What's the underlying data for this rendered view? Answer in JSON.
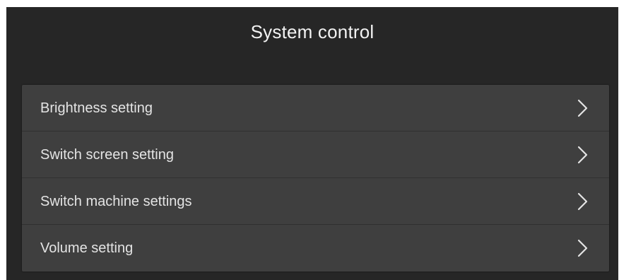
{
  "header": {
    "title": "System control"
  },
  "menu": {
    "items": [
      {
        "label": "Brightness setting",
        "icon": "chevron-right-icon"
      },
      {
        "label": "Switch screen setting",
        "icon": "chevron-right-icon"
      },
      {
        "label": "Switch machine settings",
        "icon": "chevron-right-icon"
      },
      {
        "label": "Volume setting",
        "icon": "chevron-right-icon"
      }
    ]
  },
  "colors": {
    "background": "#262626",
    "menu_background": "#3f3f3f",
    "divider": "#303030",
    "text": "#e4e4e4",
    "title_text": "#f2f2f2"
  }
}
